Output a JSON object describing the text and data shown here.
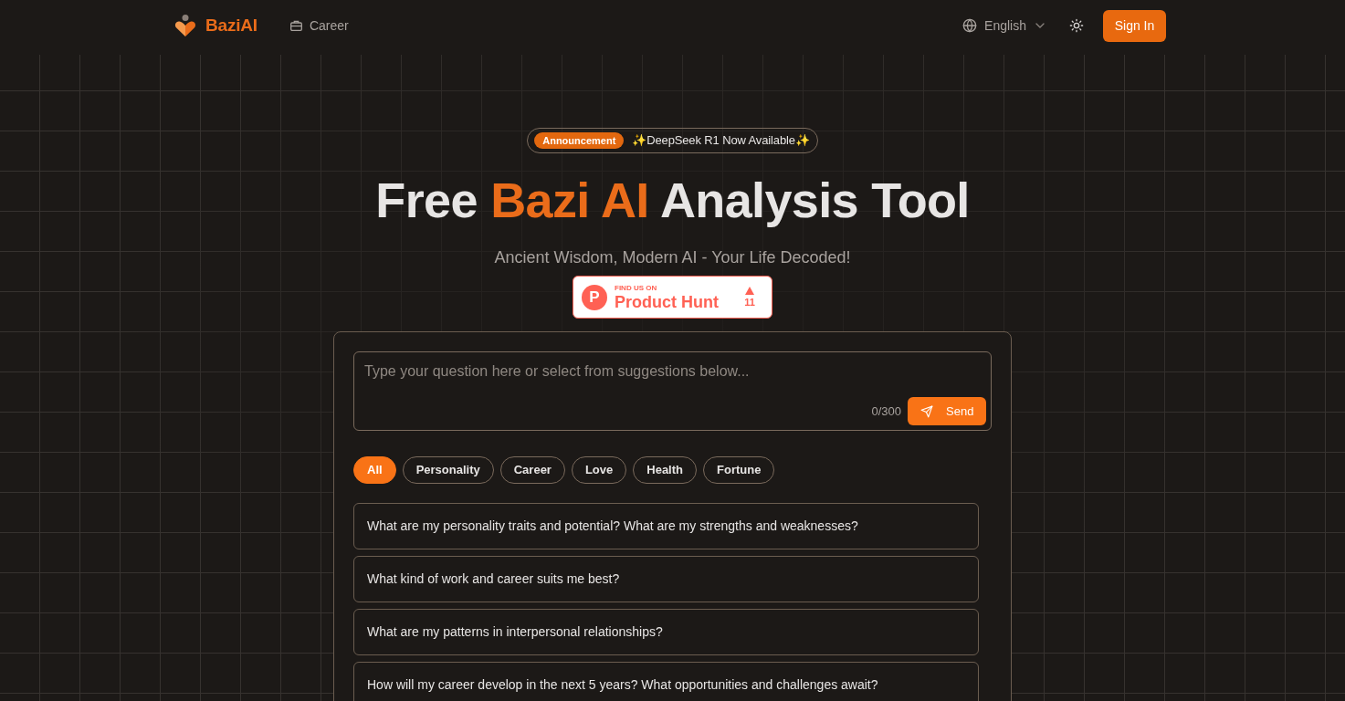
{
  "header": {
    "logo_text": "BaziAI",
    "nav": [
      {
        "label": "Career"
      }
    ],
    "language": "English",
    "sign_in": "Sign In"
  },
  "announcement": {
    "badge": "Announcement",
    "text": "✨DeepSeek R1 Now Available✨"
  },
  "hero": {
    "title": [
      {
        "text": "Free ",
        "highlight": false
      },
      {
        "text": "Bazi AI",
        "highlight": true
      },
      {
        "text": " Analysis Tool",
        "highlight": false
      }
    ],
    "subtitle": "Ancient Wisdom, Modern AI - Your Life Decoded!"
  },
  "product_hunt": {
    "logo_letter": "P",
    "eyebrow": "FIND US ON",
    "name": "Product Hunt",
    "votes": "11"
  },
  "question_box": {
    "placeholder": "Type your question here or select from suggestions below...",
    "counter": "0/300",
    "send": "Send"
  },
  "categories": [
    {
      "label": "All",
      "selected": true
    },
    {
      "label": "Personality",
      "selected": false
    },
    {
      "label": "Career",
      "selected": false
    },
    {
      "label": "Love",
      "selected": false
    },
    {
      "label": "Health",
      "selected": false
    },
    {
      "label": "Fortune",
      "selected": false
    }
  ],
  "suggestions": [
    "What are my personality traits and potential? What are my strengths and weaknesses?",
    "What kind of work and career suits me best?",
    "What are my patterns in interpersonal relationships?",
    "How will my career develop in the next 5 years? What opportunities and challenges await?"
  ]
}
